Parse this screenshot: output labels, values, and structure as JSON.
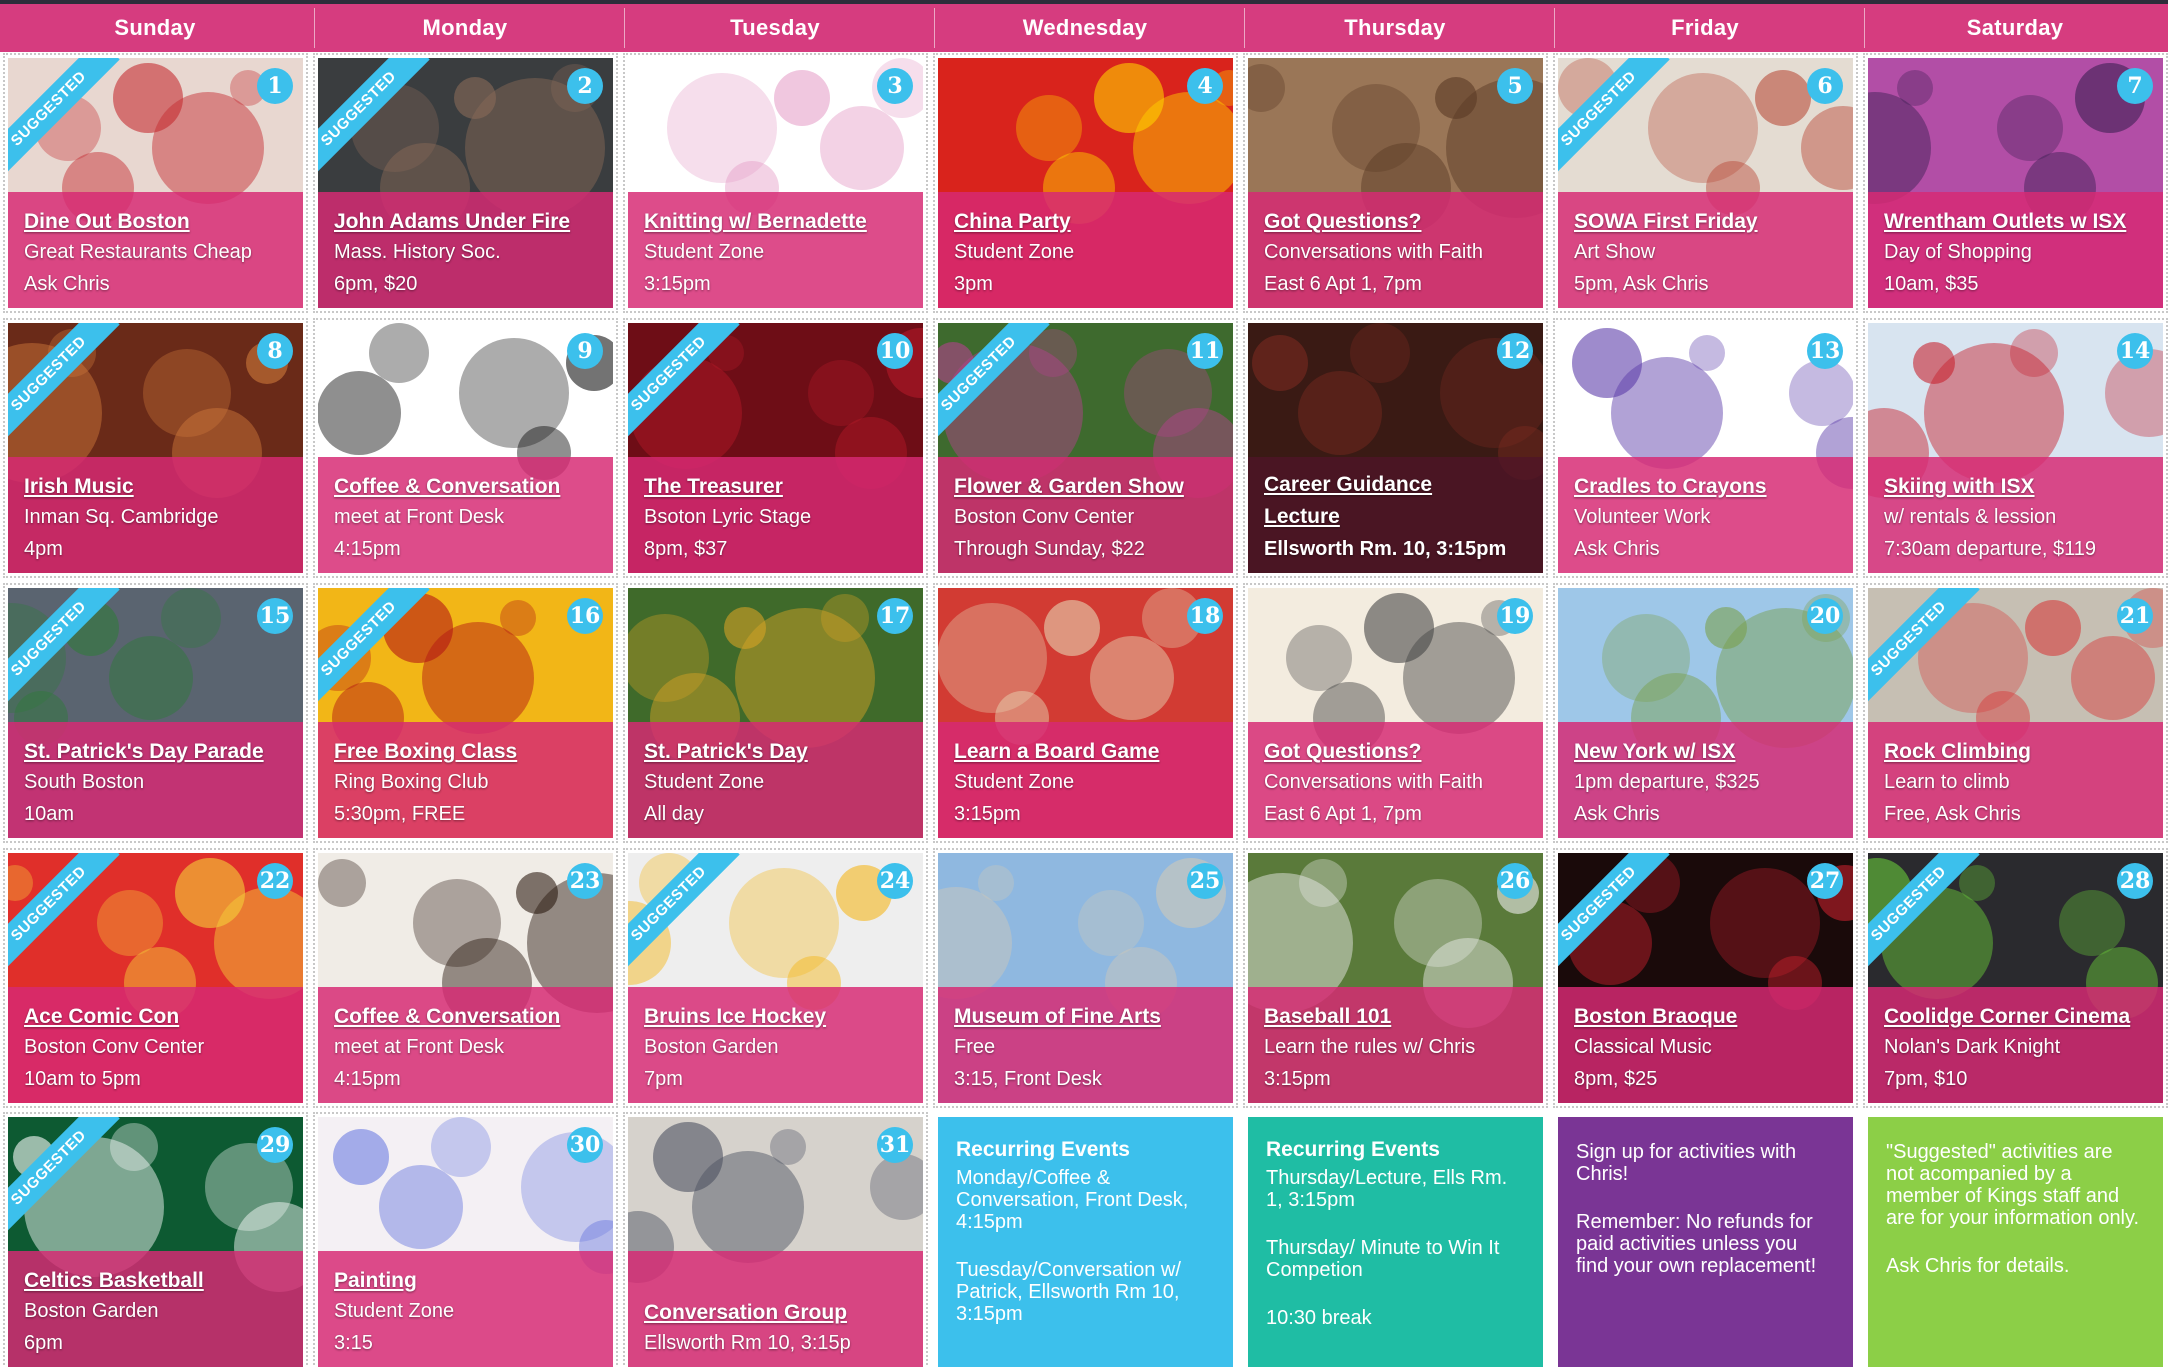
{
  "days": [
    "Sunday",
    "Monday",
    "Tuesday",
    "Wednesday",
    "Thursday",
    "Friday",
    "Saturday"
  ],
  "ribbon_label": "SUGGESTED",
  "colors": {
    "header": "#d63c7f",
    "badge": "#3cc0ec",
    "overlay": "#d62a74",
    "blue": "#3cc0ec",
    "teal": "#1fbda4",
    "purple": "#7a3595",
    "green": "#8ccf47"
  },
  "events": [
    {
      "num": "1",
      "title": "Dine Out Boston",
      "lines": [
        "Great Restaurants Cheap",
        "Ask Chris"
      ],
      "suggested": true,
      "bg": "#e8d7d0",
      "accent": "#c4282e"
    },
    {
      "num": "2",
      "title": "John Adams Under Fire",
      "lines": [
        "Mass. History Soc.",
        "6pm, $20"
      ],
      "suggested": true,
      "bg": "#3a3d3f",
      "accent": "#8a6b58"
    },
    {
      "num": "3",
      "title": "Knitting w/ Bernadette",
      "lines": [
        "Student Zone",
        "3:15pm"
      ],
      "suggested": false,
      "bg": "#ffffff",
      "accent": "#e6a0c8"
    },
    {
      "num": "4",
      "title": "China Party",
      "lines": [
        "Student Zone",
        "3pm"
      ],
      "suggested": false,
      "bg": "#d9231c",
      "accent": "#ffd500"
    },
    {
      "num": "5",
      "title": "Got Questions?",
      "lines": [
        "Conversations with Faith",
        "East 6 Apt 1, 7pm"
      ],
      "suggested": false,
      "bg": "#9a7657",
      "accent": "#5a3a24"
    },
    {
      "num": "6",
      "title": "SOWA First Friday",
      "lines": [
        "Art Show",
        "5pm, Ask Chris"
      ],
      "suggested": true,
      "bg": "#e4dcd2",
      "accent": "#b84a3a"
    },
    {
      "num": "7",
      "title": "Wrentham Outlets w ISX",
      "lines": [
        "Day of Shopping",
        "10am, $35"
      ],
      "suggested": false,
      "bg": "#b24ea6",
      "accent": "#3c1f52"
    },
    {
      "num": "8",
      "title": "Irish Music",
      "lines": [
        "Inman Sq. Cambridge",
        "4pm"
      ],
      "suggested": true,
      "bg": "#6a2a18",
      "accent": "#d07a3c"
    },
    {
      "num": "9",
      "title": "Coffee & Conversation",
      "lines": [
        "meet at Front Desk",
        "4:15pm"
      ],
      "suggested": false,
      "bg": "#ffffff",
      "accent": "#111111"
    },
    {
      "num": "10",
      "title": "The Treasurer",
      "lines": [
        "Bsoton Lyric Stage",
        "8pm, $37"
      ],
      "suggested": true,
      "bg": "#6e0d16",
      "accent": "#b51a28"
    },
    {
      "num": "11",
      "title": "Flower & Garden Show",
      "lines": [
        "Boston Conv Center",
        "Through Sunday, $22"
      ],
      "suggested": true,
      "bg": "#3e6a2e",
      "accent": "#b6408e"
    },
    {
      "num": "12",
      "title": "Career Guidance Lecture",
      "lines": [
        "Ellsworth Rm. 10, 3:15pm"
      ],
      "suggested": false,
      "bg": "#3a1a14",
      "accent": "#7a2a20",
      "bold": true
    },
    {
      "num": "13",
      "title": "Cradles to Crayons",
      "lines": [
        "Volunteer Work",
        "Ask Chris"
      ],
      "suggested": false,
      "bg": "#ffffff",
      "accent": "#5a3aa8"
    },
    {
      "num": "14",
      "title": "Skiing with ISX",
      "lines": [
        "w/ rentals & lession",
        "7:30am departure,  $119"
      ],
      "suggested": false,
      "bg": "#d8e4f0",
      "accent": "#c7202d"
    },
    {
      "num": "15",
      "title": "St. Patrick's Day Parade",
      "lines": [
        "South Boston",
        "10am"
      ],
      "suggested": true,
      "bg": "#5a6470",
      "accent": "#2f7a3a"
    },
    {
      "num": "16",
      "title": "Free Boxing Class",
      "lines": [
        "Ring Boxing Club",
        "5:30pm, FREE"
      ],
      "suggested": true,
      "bg": "#f2b617",
      "accent": "#b21414"
    },
    {
      "num": "17",
      "title": "St. Patrick's Day",
      "lines": [
        "Student Zone",
        "All day"
      ],
      "suggested": false,
      "bg": "#3f6a2a",
      "accent": "#d8a326"
    },
    {
      "num": "18",
      "title": "Learn a Board Game",
      "lines": [
        "Student Zone",
        "3:15pm"
      ],
      "suggested": false,
      "bg": "#d23b33",
      "accent": "#e8d7b4"
    },
    {
      "num": "19",
      "title": "Got Questions?",
      "lines": [
        "Conversations with Faith",
        "East 6 Apt 1, 7pm"
      ],
      "suggested": false,
      "bg": "#f3ecdf",
      "accent": "#444444"
    },
    {
      "num": "20",
      "title": "New York w/ ISX",
      "lines": [
        "1pm departure, $325",
        "Ask Chris"
      ],
      "suggested": false,
      "bg": "#9ec7e8",
      "accent": "#7aa04a"
    },
    {
      "num": "21",
      "title": "Rock Climbing",
      "lines": [
        "Learn to climb",
        "Free, Ask Chris"
      ],
      "suggested": true,
      "bg": "#c6bfb3",
      "accent": "#d63a3a"
    },
    {
      "num": "22",
      "title": "Ace Comic Con",
      "lines": [
        "Boston Conv Center",
        "10am to 5pm"
      ],
      "suggested": true,
      "bg": "#e02f2a",
      "accent": "#f5d23a"
    },
    {
      "num": "23",
      "title": "Coffee & Conversation",
      "lines": [
        "meet at Front Desk",
        "4:15pm"
      ],
      "suggested": false,
      "bg": "#f0ece6",
      "accent": "#2a1a10"
    },
    {
      "num": "24",
      "title": "Bruins Ice Hockey",
      "lines": [
        "Boston Garden",
        "7pm"
      ],
      "suggested": true,
      "bg": "#eeeeee",
      "accent": "#f4b61a"
    },
    {
      "num": "25",
      "title": "Museum of Fine Arts",
      "lines": [
        "Free",
        "3:15, Front Desk"
      ],
      "suggested": false,
      "bg": "#8fb8e0",
      "accent": "#cfc8b8"
    },
    {
      "num": "26",
      "title": "Baseball 101",
      "lines": [
        "Learn the rules w/ Chris",
        "3:15pm"
      ],
      "suggested": false,
      "bg": "#5a7a3a",
      "accent": "#eeeeee"
    },
    {
      "num": "27",
      "title": "Boston Braoque",
      "lines": [
        "Classical Music",
        "8pm, $25"
      ],
      "suggested": true,
      "bg": "#1a0a0a",
      "accent": "#c7202d"
    },
    {
      "num": "28",
      "title": "Coolidge Corner Cinema",
      "lines": [
        "Nolan's Dark Knight",
        "7pm, $10"
      ],
      "suggested": true,
      "bg": "#2a2a2e",
      "accent": "#6acd3a"
    },
    {
      "num": "29",
      "title": "Celtics Basketball",
      "lines": [
        "Boston Garden",
        "6pm"
      ],
      "suggested": true,
      "bg": "#0d5a32",
      "accent": "#ffffff"
    },
    {
      "num": "30",
      "title": "Painting",
      "lines": [
        "Student Zone",
        "3:15"
      ],
      "suggested": false,
      "bg": "#f4f0f4",
      "accent": "#6a7ae0"
    },
    {
      "num": "31",
      "title": "Conversation Group",
      "lines": [
        "Ellsworth Rm 10, 3:15p"
      ],
      "suggested": false,
      "bg": "#d6d2cc",
      "accent": "#4a5060"
    }
  ],
  "info_cards": [
    {
      "color": "#3cc0ec",
      "heading": "Recurring Events",
      "paras": [
        "Monday/Coffee & Conversation, Front Desk, 4:15pm",
        "Tuesday/Conversation w/ Patrick, Ellsworth Rm 10, 3:15pm"
      ]
    },
    {
      "color": "#1fbda4",
      "heading": "Recurring Events",
      "paras": [
        "Thursday/Lecture, Ells Rm. 1, 3:15pm",
        "Thursday/ Minute to Win It Competion",
        "10:30 break"
      ]
    },
    {
      "color": "#7a3595",
      "heading": "",
      "paras": [
        "Sign  up for activities with Chris!",
        "Remember: No refunds for paid activities unless you find your own replacement!"
      ]
    },
    {
      "color": "#8ccf47",
      "heading": "",
      "paras": [
        "\"Suggested\" activities are not acompanied by a member of Kings staff and are  for your information only.",
        "Ask Chris for details."
      ]
    }
  ]
}
